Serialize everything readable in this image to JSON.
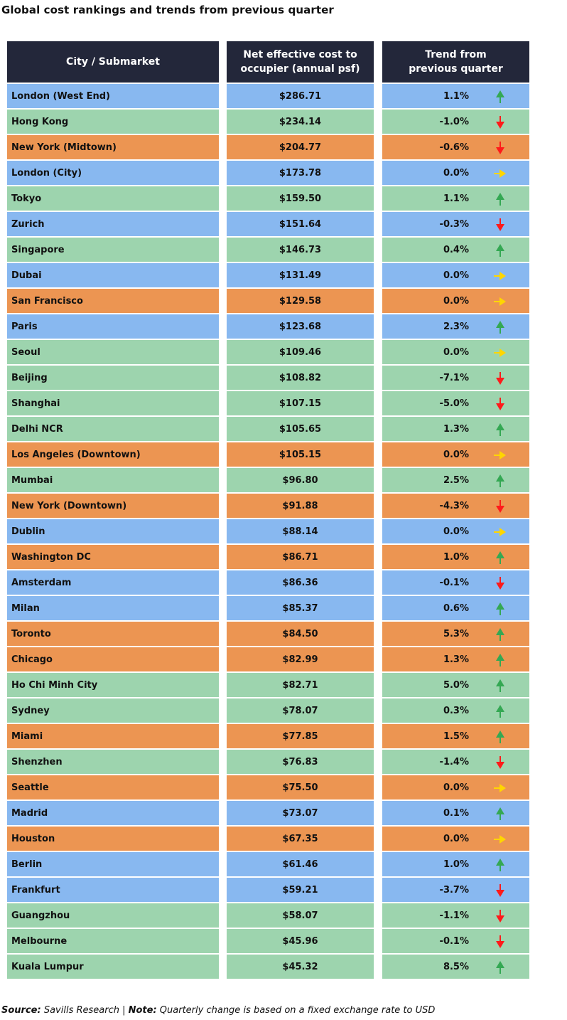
{
  "title": "Global cost rankings and trends from previous quarter",
  "colors": {
    "header_bg": "#23273a",
    "region_europe": "#88b8f0",
    "region_apac": "#9dd4ae",
    "region_americas": "#ec9552",
    "arrow_up": "#34a853",
    "arrow_down": "#ff1a1a",
    "arrow_flat": "#ffd600"
  },
  "footer": {
    "source_label": "Source:",
    "source_text": " Savills Research | ",
    "note_label": "Note:",
    "note_text": " Quarterly change is based on a fixed exchange rate to USD"
  },
  "chart_data": {
    "type": "table",
    "title": "Global cost rankings and trends from previous quarter",
    "columns": [
      "City / Submarket",
      "Net effective cost to occupier (annual psf)",
      "Trend from previous quarter"
    ],
    "rows": [
      {
        "city": "London (West End)",
        "cost": "$286.71",
        "cost_value": 286.71,
        "change": "1.1%",
        "change_value": 1.1,
        "trend": "up",
        "region": "europe"
      },
      {
        "city": "Hong Kong",
        "cost": "$234.14",
        "cost_value": 234.14,
        "change": "-1.0%",
        "change_value": -1.0,
        "trend": "down",
        "region": "apac"
      },
      {
        "city": "New York (Midtown)",
        "cost": "$204.77",
        "cost_value": 204.77,
        "change": "-0.6%",
        "change_value": -0.6,
        "trend": "down",
        "region": "americas"
      },
      {
        "city": "London (City)",
        "cost": "$173.78",
        "cost_value": 173.78,
        "change": "0.0%",
        "change_value": 0.0,
        "trend": "flat",
        "region": "europe"
      },
      {
        "city": "Tokyo",
        "cost": "$159.50",
        "cost_value": 159.5,
        "change": "1.1%",
        "change_value": 1.1,
        "trend": "up",
        "region": "apac"
      },
      {
        "city": "Zurich",
        "cost": "$151.64",
        "cost_value": 151.64,
        "change": "-0.3%",
        "change_value": -0.3,
        "trend": "down",
        "region": "europe"
      },
      {
        "city": "Singapore",
        "cost": "$146.73",
        "cost_value": 146.73,
        "change": "0.4%",
        "change_value": 0.4,
        "trend": "up",
        "region": "apac"
      },
      {
        "city": "Dubai",
        "cost": "$131.49",
        "cost_value": 131.49,
        "change": "0.0%",
        "change_value": 0.0,
        "trend": "flat",
        "region": "europe"
      },
      {
        "city": "San Francisco",
        "cost": "$129.58",
        "cost_value": 129.58,
        "change": "0.0%",
        "change_value": 0.0,
        "trend": "flat",
        "region": "americas"
      },
      {
        "city": "Paris",
        "cost": "$123.68",
        "cost_value": 123.68,
        "change": "2.3%",
        "change_value": 2.3,
        "trend": "up",
        "region": "europe"
      },
      {
        "city": "Seoul",
        "cost": "$109.46",
        "cost_value": 109.46,
        "change": "0.0%",
        "change_value": 0.0,
        "trend": "flat",
        "region": "apac"
      },
      {
        "city": "Beijing",
        "cost": "$108.82",
        "cost_value": 108.82,
        "change": "-7.1%",
        "change_value": -7.1,
        "trend": "down",
        "region": "apac"
      },
      {
        "city": "Shanghai",
        "cost": "$107.15",
        "cost_value": 107.15,
        "change": "-5.0%",
        "change_value": -5.0,
        "trend": "down",
        "region": "apac"
      },
      {
        "city": "Delhi NCR",
        "cost": "$105.65",
        "cost_value": 105.65,
        "change": "1.3%",
        "change_value": 1.3,
        "trend": "up",
        "region": "apac"
      },
      {
        "city": "Los Angeles (Downtown)",
        "cost": "$105.15",
        "cost_value": 105.15,
        "change": "0.0%",
        "change_value": 0.0,
        "trend": "flat",
        "region": "americas"
      },
      {
        "city": "Mumbai",
        "cost": "$96.80",
        "cost_value": 96.8,
        "change": "2.5%",
        "change_value": 2.5,
        "trend": "up",
        "region": "apac"
      },
      {
        "city": "New York (Downtown)",
        "cost": "$91.88",
        "cost_value": 91.88,
        "change": "-4.3%",
        "change_value": -4.3,
        "trend": "down",
        "region": "americas"
      },
      {
        "city": "Dublin",
        "cost": "$88.14",
        "cost_value": 88.14,
        "change": "0.0%",
        "change_value": 0.0,
        "trend": "flat",
        "region": "europe"
      },
      {
        "city": "Washington DC",
        "cost": "$86.71",
        "cost_value": 86.71,
        "change": "1.0%",
        "change_value": 1.0,
        "trend": "up",
        "region": "americas"
      },
      {
        "city": "Amsterdam",
        "cost": "$86.36",
        "cost_value": 86.36,
        "change": "-0.1%",
        "change_value": -0.1,
        "trend": "down",
        "region": "europe"
      },
      {
        "city": "Milan",
        "cost": "$85.37",
        "cost_value": 85.37,
        "change": "0.6%",
        "change_value": 0.6,
        "trend": "up",
        "region": "europe"
      },
      {
        "city": "Toronto",
        "cost": "$84.50",
        "cost_value": 84.5,
        "change": "5.3%",
        "change_value": 5.3,
        "trend": "up",
        "region": "americas"
      },
      {
        "city": "Chicago",
        "cost": "$82.99",
        "cost_value": 82.99,
        "change": "1.3%",
        "change_value": 1.3,
        "trend": "up",
        "region": "americas"
      },
      {
        "city": "Ho Chi Minh City",
        "cost": "$82.71",
        "cost_value": 82.71,
        "change": "5.0%",
        "change_value": 5.0,
        "trend": "up",
        "region": "apac"
      },
      {
        "city": "Sydney",
        "cost": "$78.07",
        "cost_value": 78.07,
        "change": "0.3%",
        "change_value": 0.3,
        "trend": "up",
        "region": "apac"
      },
      {
        "city": "Miami",
        "cost": "$77.85",
        "cost_value": 77.85,
        "change": "1.5%",
        "change_value": 1.5,
        "trend": "up",
        "region": "americas"
      },
      {
        "city": "Shenzhen",
        "cost": "$76.83",
        "cost_value": 76.83,
        "change": "-1.4%",
        "change_value": -1.4,
        "trend": "down",
        "region": "apac"
      },
      {
        "city": "Seattle",
        "cost": "$75.50",
        "cost_value": 75.5,
        "change": "0.0%",
        "change_value": 0.0,
        "trend": "flat",
        "region": "americas"
      },
      {
        "city": "Madrid",
        "cost": "$73.07",
        "cost_value": 73.07,
        "change": "0.1%",
        "change_value": 0.1,
        "trend": "up",
        "region": "europe"
      },
      {
        "city": "Houston",
        "cost": "$67.35",
        "cost_value": 67.35,
        "change": "0.0%",
        "change_value": 0.0,
        "trend": "flat",
        "region": "americas"
      },
      {
        "city": "Berlin",
        "cost": "$61.46",
        "cost_value": 61.46,
        "change": "1.0%",
        "change_value": 1.0,
        "trend": "up",
        "region": "europe"
      },
      {
        "city": "Frankfurt",
        "cost": "$59.21",
        "cost_value": 59.21,
        "change": "-3.7%",
        "change_value": -3.7,
        "trend": "down",
        "region": "europe"
      },
      {
        "city": "Guangzhou",
        "cost": "$58.07",
        "cost_value": 58.07,
        "change": "-1.1%",
        "change_value": -1.1,
        "trend": "down",
        "region": "apac"
      },
      {
        "city": "Melbourne",
        "cost": "$45.96",
        "cost_value": 45.96,
        "change": "-0.1%",
        "change_value": -0.1,
        "trend": "down",
        "region": "apac"
      },
      {
        "city": "Kuala Lumpur",
        "cost": "$45.32",
        "cost_value": 45.32,
        "change": "8.5%",
        "change_value": 8.5,
        "trend": "up",
        "region": "apac"
      }
    ]
  }
}
